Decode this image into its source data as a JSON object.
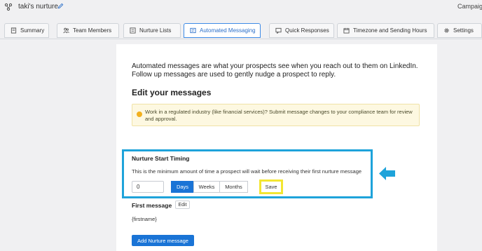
{
  "header": {
    "title": "taki's nurture",
    "right_link": "Campaign"
  },
  "tabs": [
    {
      "label": "Summary",
      "icon": "book-icon"
    },
    {
      "label": "Team Members",
      "icon": "users-icon"
    },
    {
      "label": "Nurture Lists",
      "icon": "list-icon"
    },
    {
      "label": "Automated Messaging",
      "icon": "message-icon",
      "active": true
    },
    {
      "label": "Quick Responses",
      "icon": "reply-icon"
    },
    {
      "label": "Timezone and Sending Hours",
      "icon": "calendar-icon"
    },
    {
      "label": "Settings",
      "icon": "gear-icon"
    }
  ],
  "main": {
    "intro": "Automated messages are what your prospects see when you reach out to them on LinkedIn. Follow up messages are used to gently nudge a prospect to reply.",
    "section_title": "Edit your messages",
    "notice": "Work in a regulated industry (like financial services)? Submit message changes to your compliance team for review and approval.",
    "timing": {
      "title": "Nurture Start Timing",
      "description": "This is the minimum amount of time a prospect will wait before receiving their first nurture message",
      "value": "0",
      "units": [
        "Days",
        "Weeks",
        "Months"
      ],
      "selected_unit": "Days",
      "save_label": "Save"
    },
    "first_message": {
      "label": "First message",
      "edit_label": "Edit",
      "body": "{firstname}"
    },
    "add_button": "Add Nurture message"
  },
  "colors": {
    "accent": "#1a74d6",
    "highlight_cyan": "#1ea3da",
    "highlight_yellow": "#f3e632",
    "warning": "#f2b01e"
  }
}
